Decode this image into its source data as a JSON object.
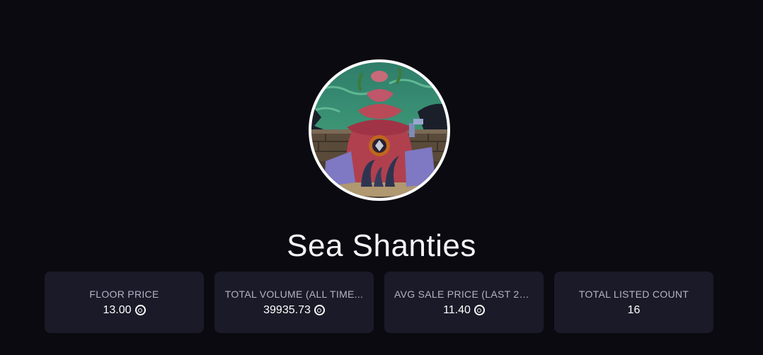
{
  "collection": {
    "name": "Sea Shanties",
    "avatar_icon": "sea-shanties-collection-avatar"
  },
  "stats": [
    {
      "label": "FLOOR PRICE",
      "value": "13.00",
      "icon": "coin-icon"
    },
    {
      "label": "TOTAL VOLUME (ALL TIME...",
      "value": "39935.73",
      "icon": "coin-icon"
    },
    {
      "label": "AVG SALE PRICE (LAST 24...",
      "value": "11.40",
      "icon": "coin-icon"
    },
    {
      "label": "TOTAL LISTED COUNT",
      "value": "16",
      "icon": ""
    }
  ],
  "colors": {
    "background": "#0b0a10",
    "card": "#1b1a28",
    "label": "#b6b4c4",
    "text": "#ffffff"
  }
}
